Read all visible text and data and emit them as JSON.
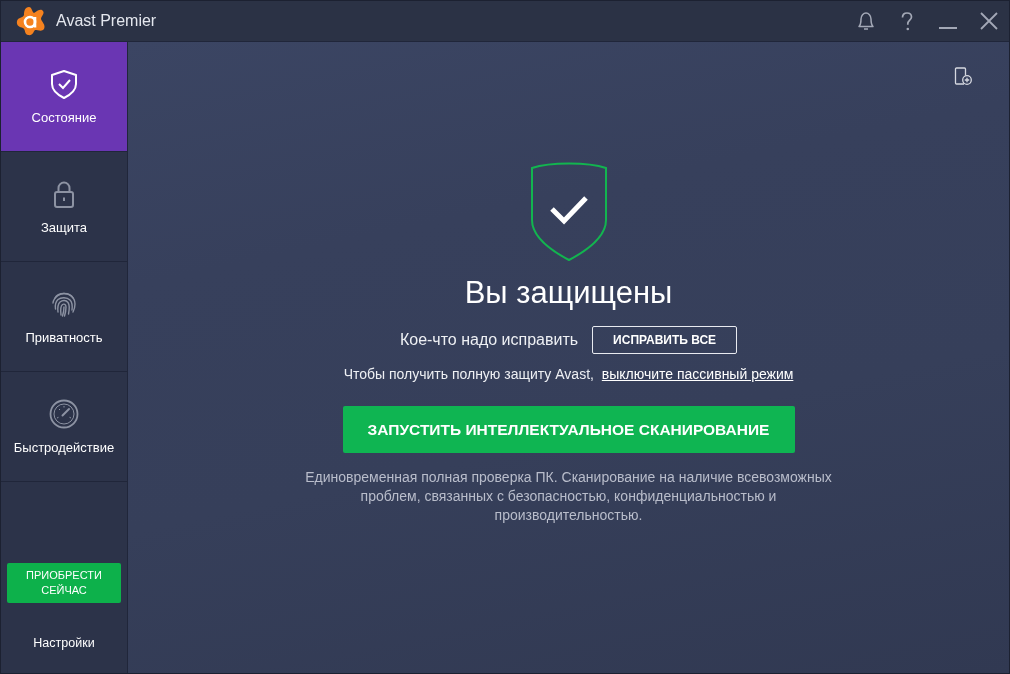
{
  "window": {
    "title": "Avast Premier"
  },
  "sidebar": {
    "items": [
      {
        "label": "Состояние",
        "selected": true
      },
      {
        "label": "Защита",
        "selected": false
      },
      {
        "label": "Приватность",
        "selected": false
      },
      {
        "label": "Быстродействие",
        "selected": false
      }
    ],
    "buy_button": "ПРИОБРЕСТИ СЕЙЧАС",
    "settings": "Настройки"
  },
  "status": {
    "title": "Вы защищены",
    "protected": true
  },
  "issues": {
    "text": "Кое-что надо исправить",
    "button": "ИСПРАВИТЬ ВСЕ"
  },
  "passive_mode": {
    "text": "Чтобы получить полную защиту Avast,",
    "link": "выключите пассивный режим"
  },
  "scan": {
    "button": "ЗАПУСТИТЬ ИНТЕЛЛЕКТУАЛЬНОЕ СКАНИРОВАНИЕ",
    "description": "Единовременная полная проверка ПК. Сканирование на наличие всевозможных проблем, связанных с безопасностью, конфиденциальностью и производительностью."
  }
}
